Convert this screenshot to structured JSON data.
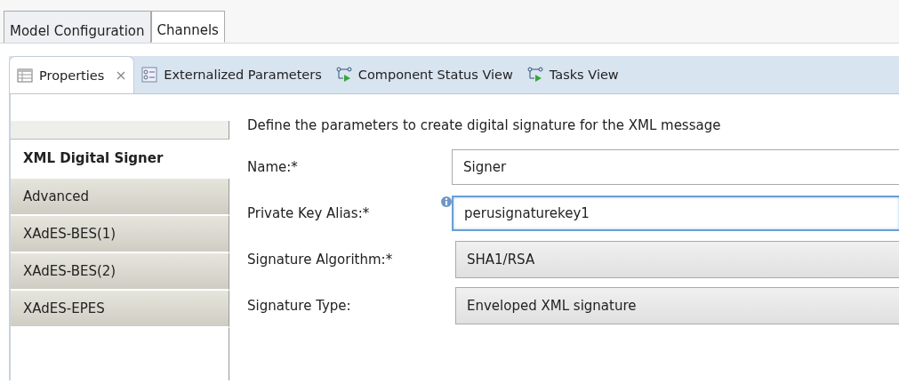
{
  "editor_tabs": [
    {
      "label": "Model Configuration",
      "selected": false
    },
    {
      "label": "Channels",
      "selected": true
    }
  ],
  "view_tabs": [
    {
      "label": "Properties",
      "selected": true
    },
    {
      "label": "Externalized Parameters",
      "selected": false
    },
    {
      "label": "Component Status View",
      "selected": false
    },
    {
      "label": "Tasks View",
      "selected": false
    }
  ],
  "sidebar": {
    "items": [
      {
        "label": "XML Digital Signer",
        "selected": true
      },
      {
        "label": "Advanced",
        "selected": false
      },
      {
        "label": "XAdES-BES(1)",
        "selected": false
      },
      {
        "label": "XAdES-BES(2)",
        "selected": false
      },
      {
        "label": "XAdES-EPES",
        "selected": false
      }
    ]
  },
  "form": {
    "description": "Define the parameters to create digital signature for the XML message",
    "fields": [
      {
        "label": "Name:*",
        "kind": "text",
        "value": "Signer",
        "focused": false,
        "info": false
      },
      {
        "label": "Private Key Alias:*",
        "kind": "text",
        "value": "perusignaturekey1",
        "focused": true,
        "info": true
      },
      {
        "label": "Signature Algorithm:*",
        "kind": "combo",
        "value": "SHA1/RSA",
        "focused": false,
        "info": false
      },
      {
        "label": "Signature Type:",
        "kind": "combo",
        "value": "Enveloped XML signature",
        "focused": false,
        "info": false
      }
    ]
  }
}
